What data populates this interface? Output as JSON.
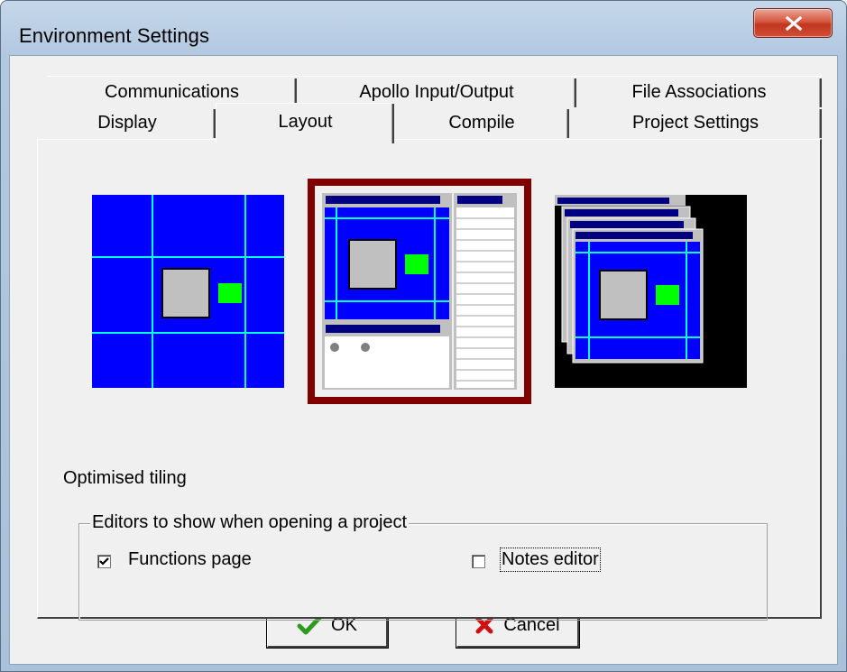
{
  "window": {
    "title": "Environment Settings",
    "close_glyph": "X"
  },
  "tabs": {
    "row1": [
      {
        "label": "Communications"
      },
      {
        "label": "Apollo Input/Output"
      },
      {
        "label": "File Associations"
      }
    ],
    "row2": [
      {
        "label": "Display"
      },
      {
        "label": "Layout"
      },
      {
        "label": "Compile"
      },
      {
        "label": "Project Settings"
      }
    ],
    "active": "Layout"
  },
  "layout": {
    "options": [
      {
        "id": "optimised-tiling",
        "icon": "tiling-layout-icon",
        "selected": false
      },
      {
        "id": "split",
        "icon": "split-layout-icon",
        "selected": true
      },
      {
        "id": "cascade",
        "icon": "cascade-layout-icon",
        "selected": false
      }
    ],
    "description": "Optimised tiling",
    "selection_color": "#800000"
  },
  "editors_group": {
    "legend": "Editors to show when opening a project",
    "functions_page": {
      "label": "Functions page",
      "checked": true
    },
    "notes_editor": {
      "label": "Notes editor",
      "checked": false
    }
  },
  "buttons": {
    "ok": {
      "label": "OK",
      "icon": "checkmark-icon"
    },
    "cancel": {
      "label": "Cancel",
      "icon": "red-x-icon"
    }
  },
  "colors": {
    "layout_blue": "#0000ff",
    "layout_grid": "#00ffff",
    "green": "#00ff00",
    "navy": "#000080"
  }
}
